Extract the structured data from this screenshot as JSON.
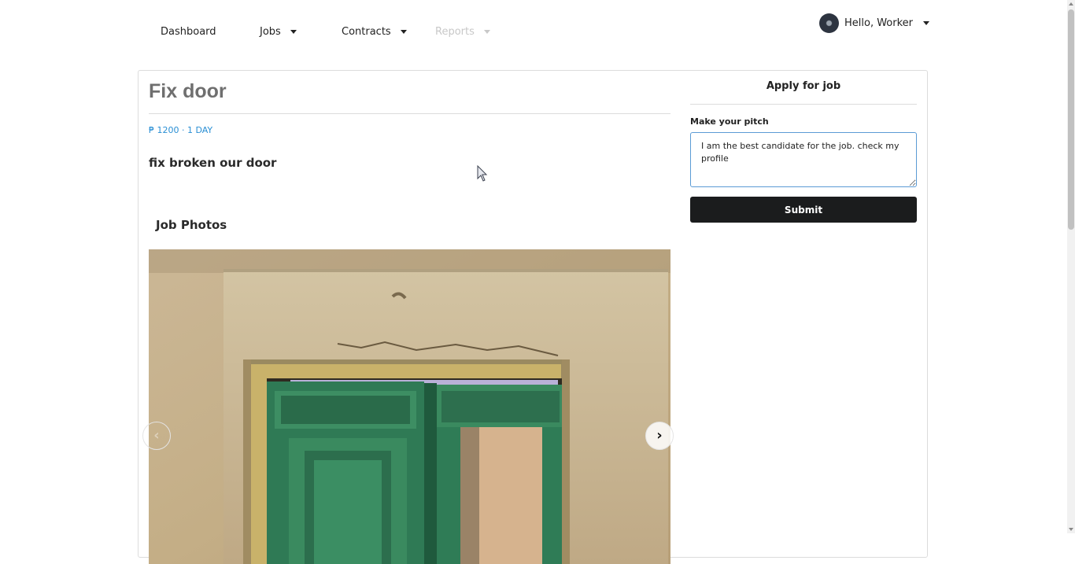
{
  "nav": {
    "items": [
      {
        "label": "Dashboard",
        "has_dropdown": false,
        "disabled": false
      },
      {
        "label": "Jobs",
        "has_dropdown": true,
        "disabled": false
      },
      {
        "label": "Contracts",
        "has_dropdown": true,
        "disabled": false
      },
      {
        "label": "Reports",
        "has_dropdown": true,
        "disabled": true
      }
    ],
    "user_greeting": "Hello, Worker"
  },
  "job": {
    "title": "Fix door",
    "meta": "₱ 1200 · 1 DAY",
    "description": "fix broken our door",
    "photos_heading": "Job Photos",
    "photo_icon": "green-door-photo"
  },
  "apply": {
    "heading": "Apply for job",
    "pitch_label": "Make your pitch",
    "pitch_value": "I am the best candidate for the job. check my profile",
    "submit_label": "Submit"
  },
  "colors": {
    "accent_blue": "#2a8fd4",
    "submit_bg": "#1b1c1d",
    "title_gray": "#6f6f6f",
    "disabled_nav": "#c8c8c8"
  }
}
